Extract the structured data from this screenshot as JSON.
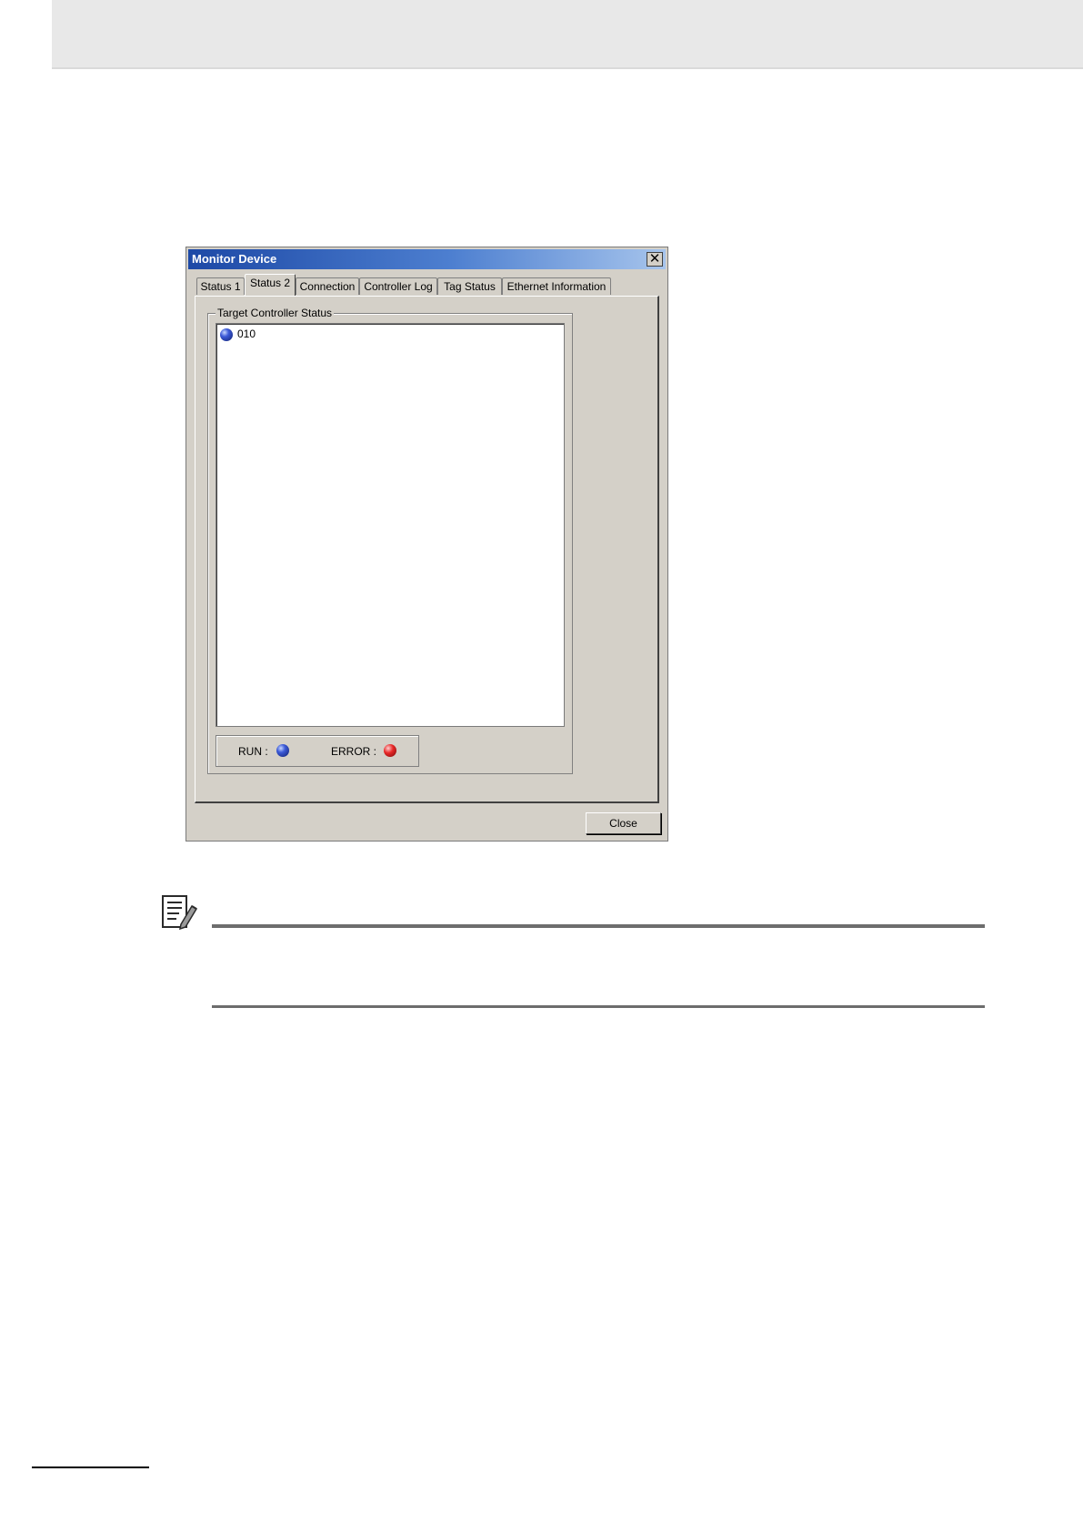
{
  "dialog": {
    "title": "Monitor Device",
    "close_glyph": "✕",
    "tabs": [
      {
        "label": "Status 1",
        "active": false
      },
      {
        "label": "Status 2",
        "active": true
      },
      {
        "label": "Connection",
        "active": false
      },
      {
        "label": "Controller Log",
        "active": false
      },
      {
        "label": "Tag Status",
        "active": false
      },
      {
        "label": "Ethernet Information",
        "active": false
      }
    ],
    "group_label": "Target Controller Status",
    "status_items": [
      {
        "label": "010",
        "led_color": "blue"
      }
    ],
    "legend": {
      "run_label": "RUN :",
      "error_label": "ERROR :"
    },
    "close_button_label": "Close"
  },
  "icons": {
    "info_note": "notepad-pencil-icon"
  },
  "colors": {
    "titlebar_start": "#1d49a6",
    "titlebar_end": "#a6c4ec",
    "dialog_face": "#d4d0c8",
    "run_led": "#3c5ad8",
    "error_led": "#e82828"
  }
}
